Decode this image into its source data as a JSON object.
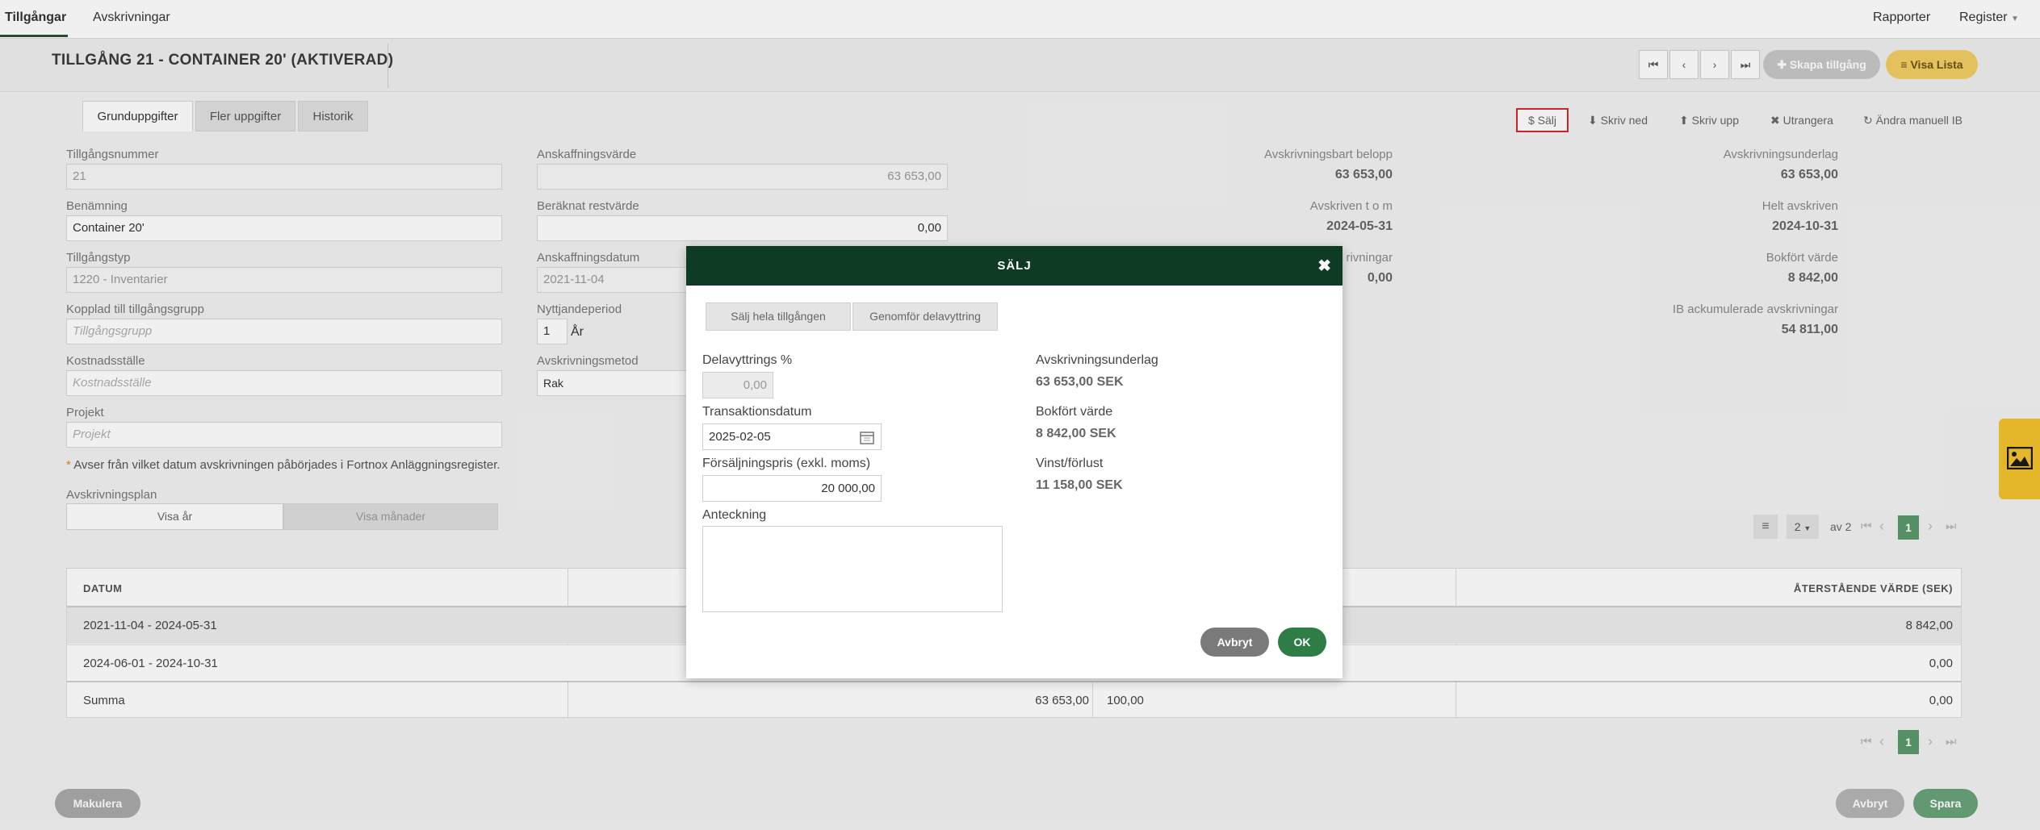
{
  "topnav": {
    "tab1": "Tillgångar",
    "tab2": "Avskrivningar",
    "reports": "Rapporter",
    "register": "Register"
  },
  "header": {
    "title": "TILLGÅNG 21 - CONTAINER 20' (AKTIVERAD)",
    "create_btn": "Skapa tillgång",
    "list_btn": "Visa Lista"
  },
  "tabs": {
    "basic": "Grunduppgifter",
    "more": "Fler uppgifter",
    "history": "Historik"
  },
  "actions": {
    "sell": "Sälj",
    "write_down": "Skriv ned",
    "write_up": "Skriv upp",
    "scrap": "Utrangera",
    "change_ib": "Ändra manuell IB"
  },
  "form": {
    "asset_no_label": "Tillgångsnummer",
    "asset_no": "21",
    "name_label": "Benämning",
    "name": "Container 20'",
    "type_label": "Tillgångstyp",
    "type": "1220 - Inventarier",
    "group_label": "Kopplad till tillgångsgrupp",
    "group_ph": "Tillgångsgrupp",
    "cost_center_label": "Kostnadsställe",
    "cost_center_ph": "Kostnadsställe",
    "project_label": "Projekt",
    "project_ph": "Projekt",
    "acq_value_label": "Anskaffningsvärde",
    "acq_value": "63 653,00",
    "residual_label": "Beräknat restvärde",
    "residual": "0,00",
    "acq_date_label": "Anskaffningsdatum",
    "acq_date": "2021-11-04",
    "life_label": "Nyttjandeperiod",
    "life": "1",
    "life_unit": "År",
    "method_label": "Avskrivningsmetod",
    "method": "Rak",
    "note": "Avser från vilket datum avskrivningen påbörjades i Fortnox Anläggningsregister.",
    "plan_label": "Avskrivningsplan",
    "plan_year": "Visa år",
    "plan_month": "Visa månader"
  },
  "summary": {
    "depr_amount_label": "Avskrivningsbart belopp",
    "depr_amount": "63 653,00",
    "depr_base_label": "Avskrivningsunderlag",
    "depr_base": "63 653,00",
    "depr_through_label": "Avskriven t o m",
    "depr_through": "2024-05-31",
    "fully_label": "Helt avskriven",
    "fully": "2024-10-31",
    "writedowns_label": "rivningar",
    "writedowns": "0,00",
    "book_value_label": "Bokfört värde",
    "book_value": "8 842,00",
    "ib_label": "IB ackumulerade avskrivningar",
    "ib": "54 811,00"
  },
  "table": {
    "col_date": "DATUM",
    "col_remaining": "ÅTERSTÅENDE VÄRDE (SEK)",
    "rows": [
      {
        "date": "2021-11-04 - 2024-05-31",
        "remaining": "8 842,00"
      },
      {
        "date": "2024-06-01 - 2024-10-31",
        "remaining": "0,00"
      }
    ],
    "sum_label": "Summa",
    "sum_value": "63 653,00",
    "sum_pct": "100,00",
    "sum_remaining": "0,00"
  },
  "pager": {
    "page_size": "2",
    "of": "av 2",
    "page": "1"
  },
  "bottom": {
    "scrap_btn": "Makulera",
    "cancel_btn": "Avbryt",
    "save_btn": "Spara"
  },
  "modal": {
    "title": "SÄLJ",
    "tab_full": "Sälj hela tillgången",
    "tab_partial": "Genomför delavyttring",
    "pct_label": "Delavyttrings %",
    "pct": "0,00",
    "date_label": "Transaktionsdatum",
    "date": "2025-02-05",
    "price_label": "Försäljningspris (exkl. moms)",
    "price": "20 000,00",
    "note_label": "Anteckning",
    "base_label": "Avskrivningsunderlag",
    "base": "63 653,00 SEK",
    "book_label": "Bokfört värde",
    "book": "8 842,00 SEK",
    "gain_label": "Vinst/förlust",
    "gain": "11 158,00 SEK",
    "cancel": "Avbryt",
    "ok": "OK"
  },
  "colors": {
    "brand_dark": "#0f3b24",
    "green": "#2e7d46",
    "yellow": "#f5c22d",
    "sell_outline": "#d9262c"
  }
}
